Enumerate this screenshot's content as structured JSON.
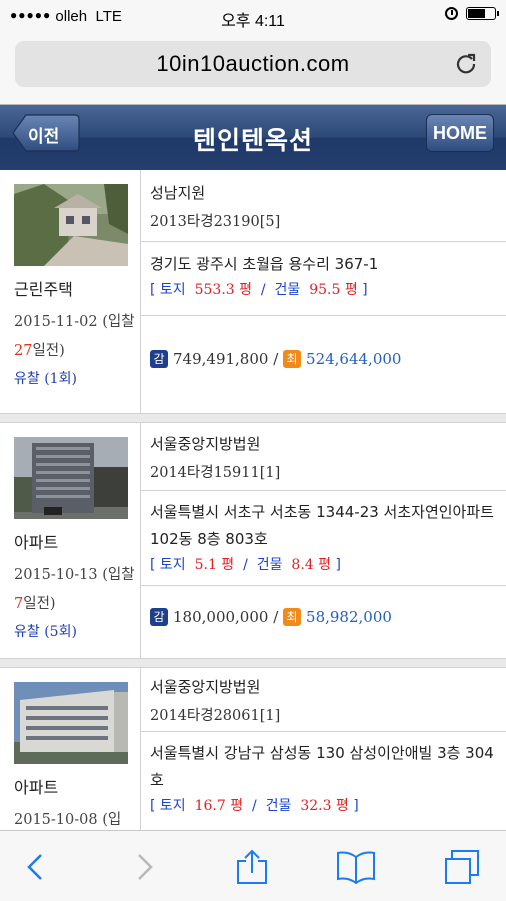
{
  "status_bar": {
    "carrier": "olleh",
    "network": "LTE",
    "time": "오후 4:11"
  },
  "browser": {
    "url": "10in10auction.com"
  },
  "header": {
    "back_label": "이전",
    "title": "텐인텐옥션",
    "home_label": "HOME"
  },
  "listings": [
    {
      "type": "근린주택",
      "date_prefix": "2015-11-02 (입찰 ",
      "days": "27",
      "date_suffix": "일전)",
      "result_label": "유찰",
      "result_count": "(1회)",
      "court": "성남지원",
      "case_no": "2013타경23190[5]",
      "address": "경기도 광주시 초월읍 용수리 367-1",
      "land_label": "토지",
      "land_area": "553.3 평",
      "bldg_label": "건물",
      "bldg_area": "95.5 평",
      "appraisal_badge": "감",
      "appraisal": "749,491,800",
      "min_badge": "최",
      "min_price": "524,644,000"
    },
    {
      "type": "아파트",
      "date_prefix": "2015-10-13 (입찰 ",
      "days": "7",
      "date_suffix": "일전)",
      "result_label": "유찰",
      "result_count": "(5회)",
      "court": "서울중앙지방법원",
      "case_no": "2014타경15911[1]",
      "address": "서울특별시 서초구 서초동 1344-23 서초자연인아파트 102동 8층 803호",
      "land_label": "토지",
      "land_area": "5.1 평",
      "bldg_label": "건물",
      "bldg_area": "8.4 평",
      "appraisal_badge": "감",
      "appraisal": "180,000,000",
      "min_badge": "최",
      "min_price": "58,982,000"
    },
    {
      "type": "아파트",
      "date_prefix": "2015-10-08 (입",
      "court": "서울중앙지방법원",
      "case_no": "2014타경28061[1]",
      "address": "서울특별시 강남구 삼성동 130 삼성이안애빌 3층 304호",
      "land_label": "토지",
      "land_area": "16.7 평",
      "bldg_label": "건물",
      "bldg_area": "32.3 평"
    }
  ],
  "icons": [
    "reload-icon",
    "alarm-icon",
    "battery-icon",
    "back-arrow-icon",
    "forward-arrow-icon",
    "share-icon",
    "bookmarks-icon",
    "tabs-icon"
  ]
}
